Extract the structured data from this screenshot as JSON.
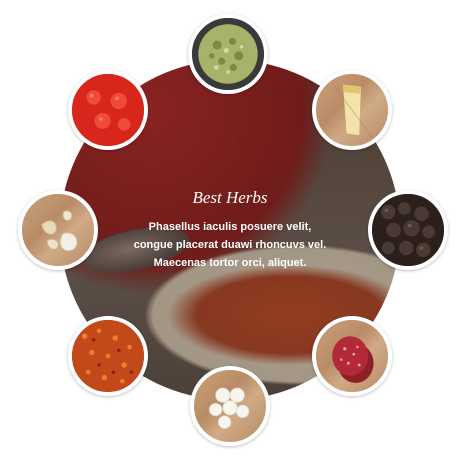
{
  "feature": {
    "title": "Best Herbs",
    "body": "Phasellus iaculis posuere velit, congue placerat duawi rhoncuvs vel. Maecenas tortor orci, aliquet."
  },
  "ingredients": [
    {
      "name": "herbs",
      "icon": "herbs-icon"
    },
    {
      "name": "cheese",
      "icon": "cheese-icon"
    },
    {
      "name": "peppercorns",
      "icon": "peppercorn-icon"
    },
    {
      "name": "salami",
      "icon": "salami-icon"
    },
    {
      "name": "mozzarella",
      "icon": "mozzarella-icon"
    },
    {
      "name": "chili flakes",
      "icon": "chili-flakes-icon"
    },
    {
      "name": "garlic",
      "icon": "garlic-icon"
    },
    {
      "name": "tomato",
      "icon": "tomato-icon"
    }
  ],
  "colors": {
    "ring_border": "#ffffff",
    "caption_text": "#ffffff",
    "sauce": "#b83a1e"
  }
}
